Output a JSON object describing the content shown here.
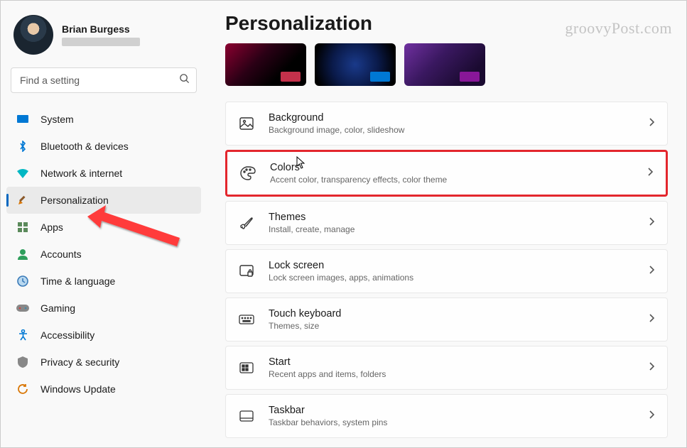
{
  "watermark": "groovyPost.com",
  "profile": {
    "name": "Brian Burgess"
  },
  "search": {
    "placeholder": "Find a setting"
  },
  "sidebar": {
    "items": [
      {
        "label": "System"
      },
      {
        "label": "Bluetooth & devices"
      },
      {
        "label": "Network & internet"
      },
      {
        "label": "Personalization"
      },
      {
        "label": "Apps"
      },
      {
        "label": "Accounts"
      },
      {
        "label": "Time & language"
      },
      {
        "label": "Gaming"
      },
      {
        "label": "Accessibility"
      },
      {
        "label": "Privacy & security"
      },
      {
        "label": "Windows Update"
      }
    ]
  },
  "page": {
    "title": "Personalization"
  },
  "settings": [
    {
      "title": "Background",
      "desc": "Background image, color, slideshow"
    },
    {
      "title": "Colors",
      "desc": "Accent color, transparency effects, color theme"
    },
    {
      "title": "Themes",
      "desc": "Install, create, manage"
    },
    {
      "title": "Lock screen",
      "desc": "Lock screen images, apps, animations"
    },
    {
      "title": "Touch keyboard",
      "desc": "Themes, size"
    },
    {
      "title": "Start",
      "desc": "Recent apps and items, folders"
    },
    {
      "title": "Taskbar",
      "desc": "Taskbar behaviors, system pins"
    }
  ]
}
